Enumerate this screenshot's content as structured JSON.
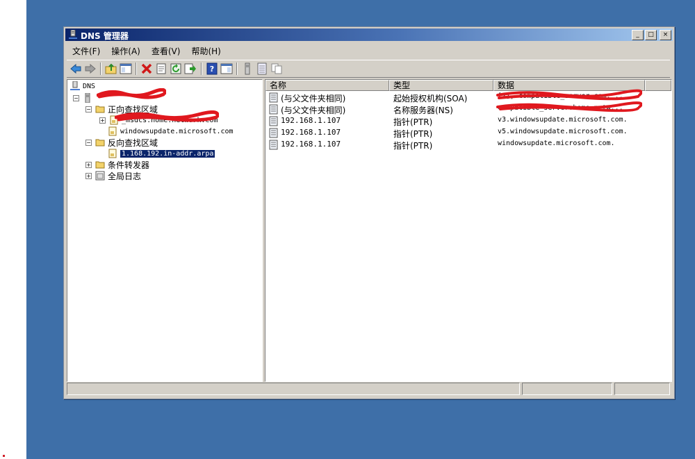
{
  "window": {
    "title": "DNS 管理器",
    "controls": [
      "_",
      "□",
      "×"
    ]
  },
  "menu": [
    "文件(F)",
    "操作(A)",
    "查看(V)",
    "帮助(H)"
  ],
  "toolbar": {
    "icons": [
      "back-arrow-icon",
      "forward-arrow-icon",
      "up-folder-icon",
      "show-hide-tree-icon",
      "delete-icon",
      "properties-icon",
      "refresh-icon",
      "export-list-icon",
      "help-icon",
      "console-window-icon",
      "server-icon",
      "list-icon",
      "copy-icon"
    ]
  },
  "tree": {
    "root": "DNS",
    "server": "",
    "forward_zones": "正向查找区域",
    "forward_child_1": "_msdcs.home.network.com",
    "forward_child_2": "windowsupdate.microsoft.com",
    "reverse_zones": "反向查找区域",
    "reverse_child_1": "1.168.192.in-addr.arpa",
    "conditional_forwarders": "条件转发器",
    "global_logs": "全局日志"
  },
  "list": {
    "columns": [
      "名称",
      "类型",
      "数据"
    ],
    "rows": [
      {
        "name": "(与父文件夹相同)",
        "type": "起始授权机构(SOA)",
        "data": "[2], compatible_server.com, ..."
      },
      {
        "name": "(与父文件夹相同)",
        "type": "名称服务器(NS)",
        "data": "compatible_server.home.netw..."
      },
      {
        "name": "192.168.1.107",
        "type": "指针(PTR)",
        "data": "v3.windowsupdate.microsoft.com."
      },
      {
        "name": "192.168.1.107",
        "type": "指针(PTR)",
        "data": "v5.windowsupdate.microsoft.com."
      },
      {
        "name": "192.168.1.107",
        "type": "指针(PTR)",
        "data": "windowsupdate.microsoft.com."
      }
    ]
  },
  "status": {
    "pane1": "",
    "pane2": "",
    "pane3": ""
  }
}
